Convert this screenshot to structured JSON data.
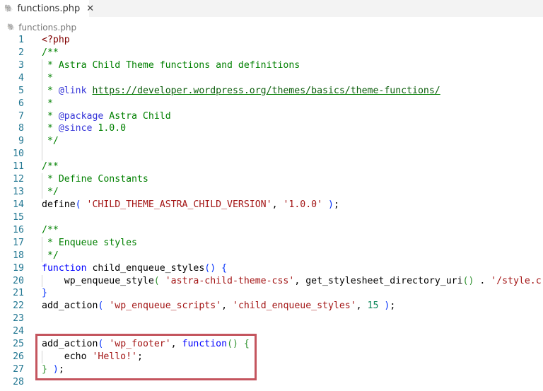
{
  "tab": {
    "label": "functions.php",
    "icon": "php-elephant-icon",
    "close_icon": "close-icon"
  },
  "breadcrumb": {
    "label": "functions.php",
    "icon": "php-elephant-icon"
  },
  "colors": {
    "line_number": "#237893",
    "keyword": "#0000ff",
    "string": "#a31515",
    "comment": "#008000",
    "number": "#098658",
    "highlight_box": "#c4555e"
  },
  "lines": [
    {
      "n": "1",
      "g": false,
      "t": [
        [
          "php",
          "<?php"
        ]
      ]
    },
    {
      "n": "2",
      "g": false,
      "t": [
        [
          "c",
          "/**"
        ]
      ]
    },
    {
      "n": "3",
      "g": true,
      "t": [
        [
          "c",
          " * Astra Child Theme functions and definitions"
        ]
      ]
    },
    {
      "n": "4",
      "g": true,
      "t": [
        [
          "c",
          " *"
        ]
      ]
    },
    {
      "n": "5",
      "g": true,
      "t": [
        [
          "c",
          " * "
        ],
        [
          "t",
          "@link"
        ],
        [
          "c",
          " "
        ],
        [
          "u",
          "https://developer.wordpress.org/themes/basics/theme-functions/"
        ]
      ]
    },
    {
      "n": "6",
      "g": true,
      "t": [
        [
          "c",
          " *"
        ]
      ]
    },
    {
      "n": "7",
      "g": true,
      "t": [
        [
          "c",
          " * "
        ],
        [
          "t",
          "@package"
        ],
        [
          "c",
          " Astra Child"
        ]
      ]
    },
    {
      "n": "8",
      "g": true,
      "t": [
        [
          "c",
          " * "
        ],
        [
          "t",
          "@since"
        ],
        [
          "c",
          " 1.0.0"
        ]
      ]
    },
    {
      "n": "9",
      "g": true,
      "t": [
        [
          "c",
          " */"
        ]
      ]
    },
    {
      "n": "10",
      "g": true,
      "t": []
    },
    {
      "n": "11",
      "g": false,
      "t": [
        [
          "c",
          "/**"
        ]
      ]
    },
    {
      "n": "12",
      "g": true,
      "t": [
        [
          "c",
          " * Define Constants"
        ]
      ]
    },
    {
      "n": "13",
      "g": true,
      "t": [
        [
          "c",
          " */"
        ]
      ]
    },
    {
      "n": "14",
      "g": false,
      "t": [
        [
          "p",
          "define"
        ],
        [
          "b1",
          "("
        ],
        [
          "p",
          " "
        ],
        [
          "s",
          "'CHILD_THEME_ASTRA_CHILD_VERSION'"
        ],
        [
          "p",
          ", "
        ],
        [
          "s",
          "'1.0.0'"
        ],
        [
          "p",
          " "
        ],
        [
          "b1",
          ")"
        ],
        [
          "p",
          ";"
        ]
      ]
    },
    {
      "n": "15",
      "g": false,
      "t": []
    },
    {
      "n": "16",
      "g": false,
      "t": [
        [
          "c",
          "/**"
        ]
      ]
    },
    {
      "n": "17",
      "g": true,
      "t": [
        [
          "c",
          " * Enqueue styles"
        ]
      ]
    },
    {
      "n": "18",
      "g": true,
      "t": [
        [
          "c",
          " */"
        ]
      ]
    },
    {
      "n": "19",
      "g": false,
      "t": [
        [
          "k",
          "function"
        ],
        [
          "p",
          " child_enqueue_styles"
        ],
        [
          "b1",
          "()"
        ],
        [
          "p",
          " "
        ],
        [
          "b1",
          "{"
        ]
      ]
    },
    {
      "n": "20",
      "g": true,
      "t": [
        [
          "p",
          "    wp_enqueue_style"
        ],
        [
          "b2",
          "("
        ],
        [
          "p",
          " "
        ],
        [
          "s",
          "'astra-child-theme-css'"
        ],
        [
          "p",
          ", get_stylesheet_directory_uri"
        ],
        [
          "b2",
          "()"
        ],
        [
          "p",
          " . "
        ],
        [
          "s",
          "'/style.c"
        ]
      ]
    },
    {
      "n": "21",
      "g": false,
      "t": [
        [
          "b1",
          "}"
        ]
      ]
    },
    {
      "n": "22",
      "g": false,
      "t": [
        [
          "p",
          "add_action"
        ],
        [
          "b1",
          "("
        ],
        [
          "p",
          " "
        ],
        [
          "s",
          "'wp_enqueue_scripts'"
        ],
        [
          "p",
          ", "
        ],
        [
          "s",
          "'child_enqueue_styles'"
        ],
        [
          "p",
          ", "
        ],
        [
          "n",
          "15"
        ],
        [
          "p",
          " "
        ],
        [
          "b1",
          ")"
        ],
        [
          "p",
          ";"
        ]
      ]
    },
    {
      "n": "23",
      "g": false,
      "t": []
    },
    {
      "n": "24",
      "g": false,
      "t": []
    },
    {
      "n": "25",
      "g": false,
      "t": [
        [
          "p",
          "add_action"
        ],
        [
          "b1",
          "("
        ],
        [
          "p",
          " "
        ],
        [
          "s",
          "'wp_footer'"
        ],
        [
          "p",
          ", "
        ],
        [
          "k",
          "function"
        ],
        [
          "b2",
          "()"
        ],
        [
          "p",
          " "
        ],
        [
          "b2",
          "{"
        ]
      ]
    },
    {
      "n": "26",
      "g": true,
      "t": [
        [
          "p",
          "    echo "
        ],
        [
          "s",
          "'Hello!'"
        ],
        [
          "p",
          ";"
        ]
      ]
    },
    {
      "n": "27",
      "g": false,
      "t": [
        [
          "b2",
          "}"
        ],
        [
          "p",
          " "
        ],
        [
          "b1",
          ")"
        ],
        [
          "p",
          ";"
        ]
      ]
    },
    {
      "n": "28",
      "g": false,
      "t": []
    }
  ]
}
